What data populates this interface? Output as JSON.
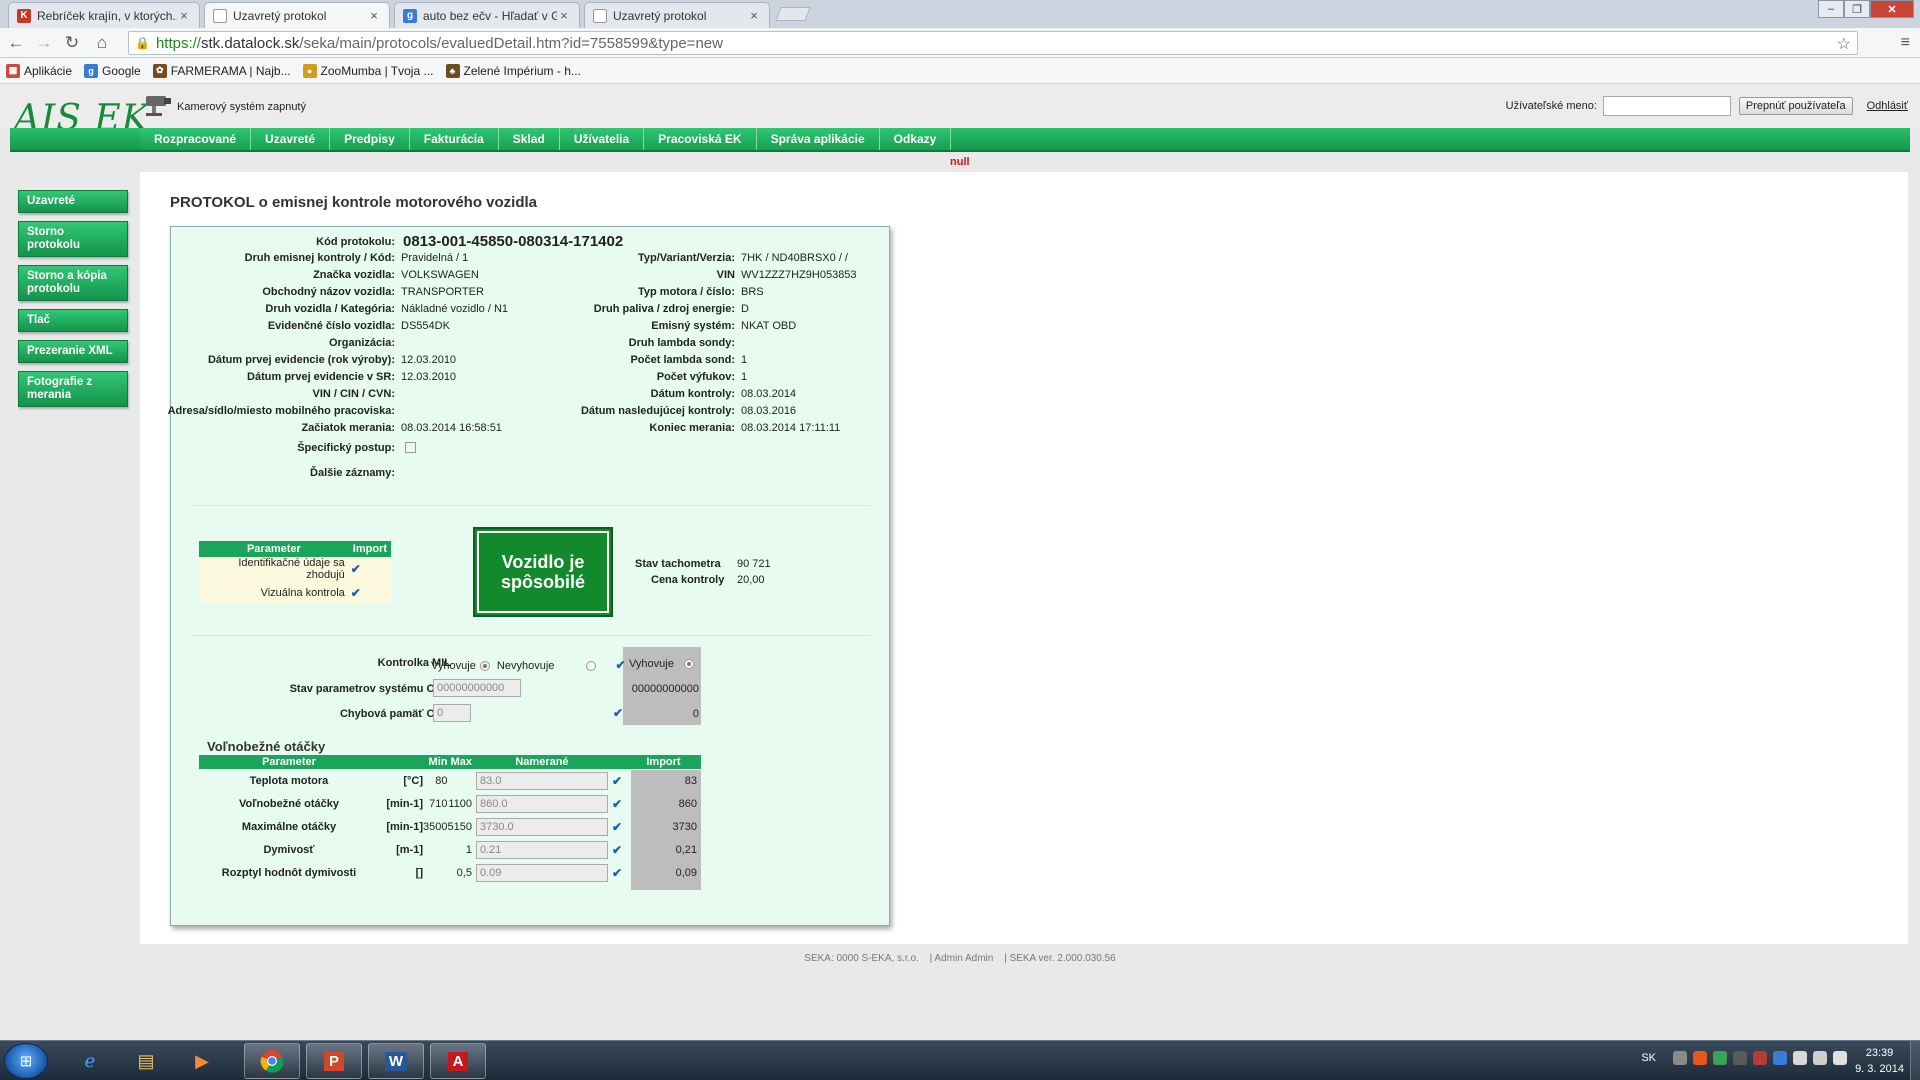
{
  "browser": {
    "tabs": [
      {
        "title": "Rebríček krajín, v ktorých..."
      },
      {
        "title": "Uzavretý protokol"
      },
      {
        "title": "auto bez ečv - Hľadať v G..."
      },
      {
        "title": "Uzavretý protokol"
      }
    ],
    "url_scheme": "https://",
    "url_host": "stk.datalock.sk",
    "url_path": "/seka/main/protocols/evaluedDetail.htm?id=7558599&type=new",
    "bookmarks": [
      "Aplikácie",
      "Google",
      "FARMERAMA | Najb...",
      "ZooMumba | Tvoja ...",
      "Zelené Impérium - h..."
    ]
  },
  "header": {
    "logo": "AIS EK",
    "camera_status": "Kamerový systém zapnutý",
    "username_label": "Užívateľské meno:",
    "switch_user_button": "Prepnúť používateľa",
    "logout_link": "Odhlásiť"
  },
  "mainnav": [
    "Rozpracované",
    "Uzavreté",
    "Predpisy",
    "Fakturácia",
    "Sklad",
    "Užívatelia",
    "Pracoviská EK",
    "Správa aplikácie",
    "Odkazy"
  ],
  "null_text": "null",
  "sidenav": [
    "Uzavreté",
    "Storno protokolu",
    "Storno a kópia protokolu",
    "Tlač",
    "Prezeranie XML",
    "Fotografie z merania"
  ],
  "page_title": "PROTOKOL o emisnej kontrole motorového vozidla",
  "protocol": {
    "kod_label": "Kód protokolu:",
    "kod_value": "0813-001-45850-080314-171402",
    "left": [
      {
        "label": "Druh emisnej kontroly / Kód:",
        "value": "Pravidelná / 1"
      },
      {
        "label": "Značka vozidla:",
        "value": "VOLKSWAGEN"
      },
      {
        "label": "Obchodný názov vozidla:",
        "value": "TRANSPORTER"
      },
      {
        "label": "Druh vozidla / Kategória:",
        "value": "Nákladné vozidlo / N1"
      },
      {
        "label": "Evidenčné číslo vozidla:",
        "value": "DS554DK"
      },
      {
        "label": "Organizácia:",
        "value": ""
      },
      {
        "label": "Dátum prvej evidencie (rok výroby):",
        "value": "12.03.2010"
      },
      {
        "label": "Dátum prvej evidencie v SR:",
        "value": "12.03.2010"
      },
      {
        "label": "VIN / CIN / CVN:",
        "value": ""
      },
      {
        "label": "Adresa/sídlo/miesto mobilného pracoviska:",
        "value": ""
      },
      {
        "label": "Začiatok merania:",
        "value": "08.03.2014 16:58:51"
      }
    ],
    "right": [
      {
        "label": "Typ/Variant/Verzia:",
        "value": "7HK / ND40BRSX0 / /"
      },
      {
        "label": "VIN",
        "value": "WV1ZZZ7HZ9H053853"
      },
      {
        "label": "Typ motora / číslo:",
        "value": "BRS"
      },
      {
        "label": "Druh paliva / zdroj energie:",
        "value": "D"
      },
      {
        "label": "Emisný systém:",
        "value": "NKAT OBD"
      },
      {
        "label": "Druh lambda sondy:",
        "value": ""
      },
      {
        "label": "Počet lambda sond:",
        "value": "1"
      },
      {
        "label": "Počet výfukov:",
        "value": "1"
      },
      {
        "label": "Dátum kontroly:",
        "value": "08.03.2014"
      },
      {
        "label": "Dátum nasledujúcej kontroly:",
        "value": "08.03.2016"
      },
      {
        "label": "Koniec merania:",
        "value": "08.03.2014 17:11:11"
      }
    ],
    "specificky_postup_label": "Špecifický postup:",
    "dalsie_zaznamy_label": "Ďalšie záznamy:"
  },
  "id_table": {
    "headers": [
      "Parameter",
      "Import"
    ],
    "rows": [
      "Identifikačné údaje sa zhodujú",
      "Vizuálna kontrola"
    ]
  },
  "verdict": "Vozidlo je spôsobilé",
  "tacho": {
    "label": "Stav tachometra",
    "value": "90 721"
  },
  "price": {
    "label": "Cena kontroly",
    "value": "20,00"
  },
  "obd": {
    "mil_label": "Kontrolka MIL",
    "vyhovuje": "Vyhovuje",
    "nevyhovuje": "Nevyhovuje",
    "import_vyhovuje": "Vyhovuje",
    "param_label": "Stav parametrov systému OBD",
    "param_value": "00000000000",
    "param_import": "00000000000",
    "error_label": "Chybová pamäť OBD",
    "error_value": "0",
    "error_import": "0"
  },
  "idle": {
    "section_title": "Voľnobežné otáčky",
    "headers": [
      "Parameter",
      "Min",
      "Max",
      "Namerané",
      "Import"
    ],
    "rows": [
      {
        "name": "Teplota motora",
        "unit": "[°C]",
        "min": "80",
        "max": "",
        "measured": "83.0",
        "import": "83"
      },
      {
        "name": "Voľnobežné otáčky",
        "unit": "[min-1]",
        "min": "710",
        "max": "1100",
        "measured": "860.0",
        "import": "860"
      },
      {
        "name": "Maximálne otáčky",
        "unit": "[min-1]",
        "min": "3500",
        "max": "5150",
        "measured": "3730.0",
        "import": "3730"
      },
      {
        "name": "Dymivosť",
        "unit": "[m-1]",
        "min": "",
        "max": "1",
        "measured": "0.21",
        "import": "0,21"
      },
      {
        "name": "Rozptyl hodnôt dymivosti",
        "unit": "[]",
        "min": "",
        "max": "0,5",
        "measured": "0.09",
        "import": "0,09"
      }
    ]
  },
  "footer": {
    "company": "SEKA: 0000 S-EKA, s.r.o.",
    "user": "| Admin Admin",
    "version": "| SEKA ver. 2.000.030.56"
  },
  "taskbar": {
    "lang": "SK",
    "time": "23:39",
    "date": "9. 3. 2014"
  },
  "colors": {
    "accent_green": "#1aa55a",
    "panel_bg": "#e8fbf1",
    "verdict_green": "#128a2c"
  }
}
